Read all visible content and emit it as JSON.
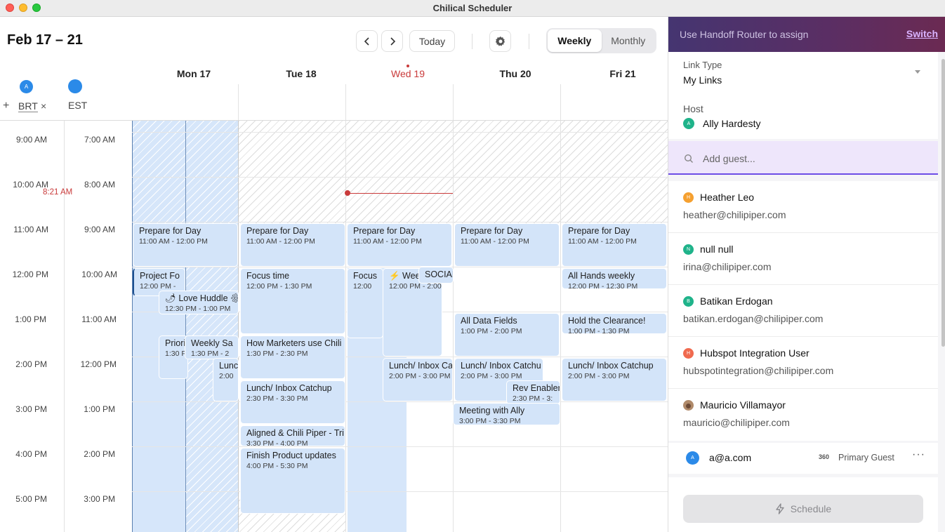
{
  "window": {
    "title": "Chilical Scheduler"
  },
  "header": {
    "range": "Feb 17 – 21",
    "today_label": "Today",
    "views": [
      "Weekly",
      "Monthly"
    ],
    "active_view": "Weekly"
  },
  "timezones": [
    {
      "code": "BRT",
      "avatar": "A",
      "color": "#2b8ae8"
    },
    {
      "code": "EST",
      "avatar": "",
      "color": "#2b8ae8"
    }
  ],
  "days": [
    {
      "label": "Mon 17",
      "today": false
    },
    {
      "label": "Tue 18",
      "today": false
    },
    {
      "label": "Wed 19",
      "today": true
    },
    {
      "label": "Thu 20",
      "today": false
    },
    {
      "label": "Fri 21",
      "today": false
    }
  ],
  "time_rows": [
    {
      "brt": "9:00 AM",
      "est": "7:00 AM"
    },
    {
      "brt": "10:00 AM",
      "est": "8:00 AM"
    },
    {
      "brt": "11:00 AM",
      "est": "9:00 AM"
    },
    {
      "brt": "12:00 PM",
      "est": "10:00 AM"
    },
    {
      "brt": "1:00 PM",
      "est": "11:00 AM"
    },
    {
      "brt": "2:00 PM",
      "est": "12:00 PM"
    },
    {
      "brt": "3:00 PM",
      "est": "1:00 PM"
    },
    {
      "brt": "4:00 PM",
      "est": "2:00 PM"
    },
    {
      "brt": "5:00 PM",
      "est": "3:00 PM"
    }
  ],
  "current_time": "8:21 AM",
  "events": [
    {
      "title": "Prepare for Day",
      "time": "11:00 AM - 12:00 PM"
    },
    {
      "title": "Prepare for Day",
      "time": "11:00 AM - 12:00 PM"
    },
    {
      "title": "Prepare for Day",
      "time": "11:00 AM - 12:00 PM"
    },
    {
      "title": "Prepare for Day",
      "time": "11:00 AM - 12:00 PM"
    },
    {
      "title": "Prepare for Day",
      "time": "11:00 AM - 12:00 PM"
    },
    {
      "title": "Project Fo",
      "time": "12:00 PM -"
    },
    {
      "title": "🌶 Love Huddle ⚙",
      "time": "12:30 PM - 1:00 PM"
    },
    {
      "title": "Priori",
      "time": "1:30 P"
    },
    {
      "title": "Weekly Sa",
      "time": "1:30 PM - 2"
    },
    {
      "title": "Lunc",
      "time": "2:00"
    },
    {
      "title": "Focus time",
      "time": "12:00 PM - 1:30 PM"
    },
    {
      "title": "How Marketers use Chili",
      "time": "1:30 PM - 2:30 PM"
    },
    {
      "title": "Lunch/ Inbox Catchup",
      "time": "2:30 PM - 3:30 PM"
    },
    {
      "title": "Aligned & Chili Piper - Tri",
      "time": "3:30 PM - 4:00 PM"
    },
    {
      "title": "Finish Product updates",
      "time": "4:00 PM - 5:30 PM"
    },
    {
      "title": "Focus",
      "time": "12:00"
    },
    {
      "title": "⚡ Wee",
      "time": "12:00 PM - 2:00"
    },
    {
      "title": "SOCIAL",
      "time": ""
    },
    {
      "title": "Lunch/ Inbox Ca",
      "time": "2:00 PM - 3:00 PM"
    },
    {
      "title": "All Data Fields",
      "time": "1:00 PM - 2:00 PM"
    },
    {
      "title": "Lunch/ Inbox Catchu",
      "time": "2:00 PM - 3:00 PM"
    },
    {
      "title": "Rev Enabler",
      "time": "2:30 PM - 3:"
    },
    {
      "title": "Meeting with Ally",
      "time": "3:00 PM - 3:30 PM"
    },
    {
      "title": "All Hands weekly",
      "time": "12:00 PM - 12:30 PM"
    },
    {
      "title": "Hold the Clearance!",
      "time": "1:00 PM - 1:30 PM"
    },
    {
      "title": "Lunch/ Inbox Catchup",
      "time": "2:00 PM - 3:00 PM"
    }
  ],
  "panel": {
    "banner_text": "Use Handoff Router to assign",
    "banner_link": "Switch",
    "link_type_label": "Link Type",
    "link_type_value": "My Links",
    "host_label": "Host",
    "host_avatar": "A",
    "host_name": "Ally Hardesty",
    "guest_placeholder": "Add guest...",
    "suggestions": [
      {
        "name": "Heather Leo",
        "email": "heather@chilipiper.com",
        "avatar": "H",
        "color": "#f5a030"
      },
      {
        "name": "null null",
        "email": "irina@chilipiper.com",
        "avatar": "N",
        "color": "#1fb38a"
      },
      {
        "name": "Batikan Erdogan",
        "email": "batikan.erdogan@chilipiper.com",
        "avatar": "B",
        "color": "#1fb38a"
      },
      {
        "name": "Hubspot Integration User",
        "email": "hubspotintegration@chilipiper.com",
        "avatar": "H",
        "color": "#f06a4f"
      },
      {
        "name": "Mauricio Villamayor",
        "email": "mauricio@chilipiper.com",
        "avatar": "",
        "color": "#b08a6a"
      }
    ],
    "selected_guest": {
      "email": "a@a.com",
      "avatar": "A",
      "role": "Primary Guest",
      "badge": "360"
    },
    "schedule_label": "Schedule"
  }
}
